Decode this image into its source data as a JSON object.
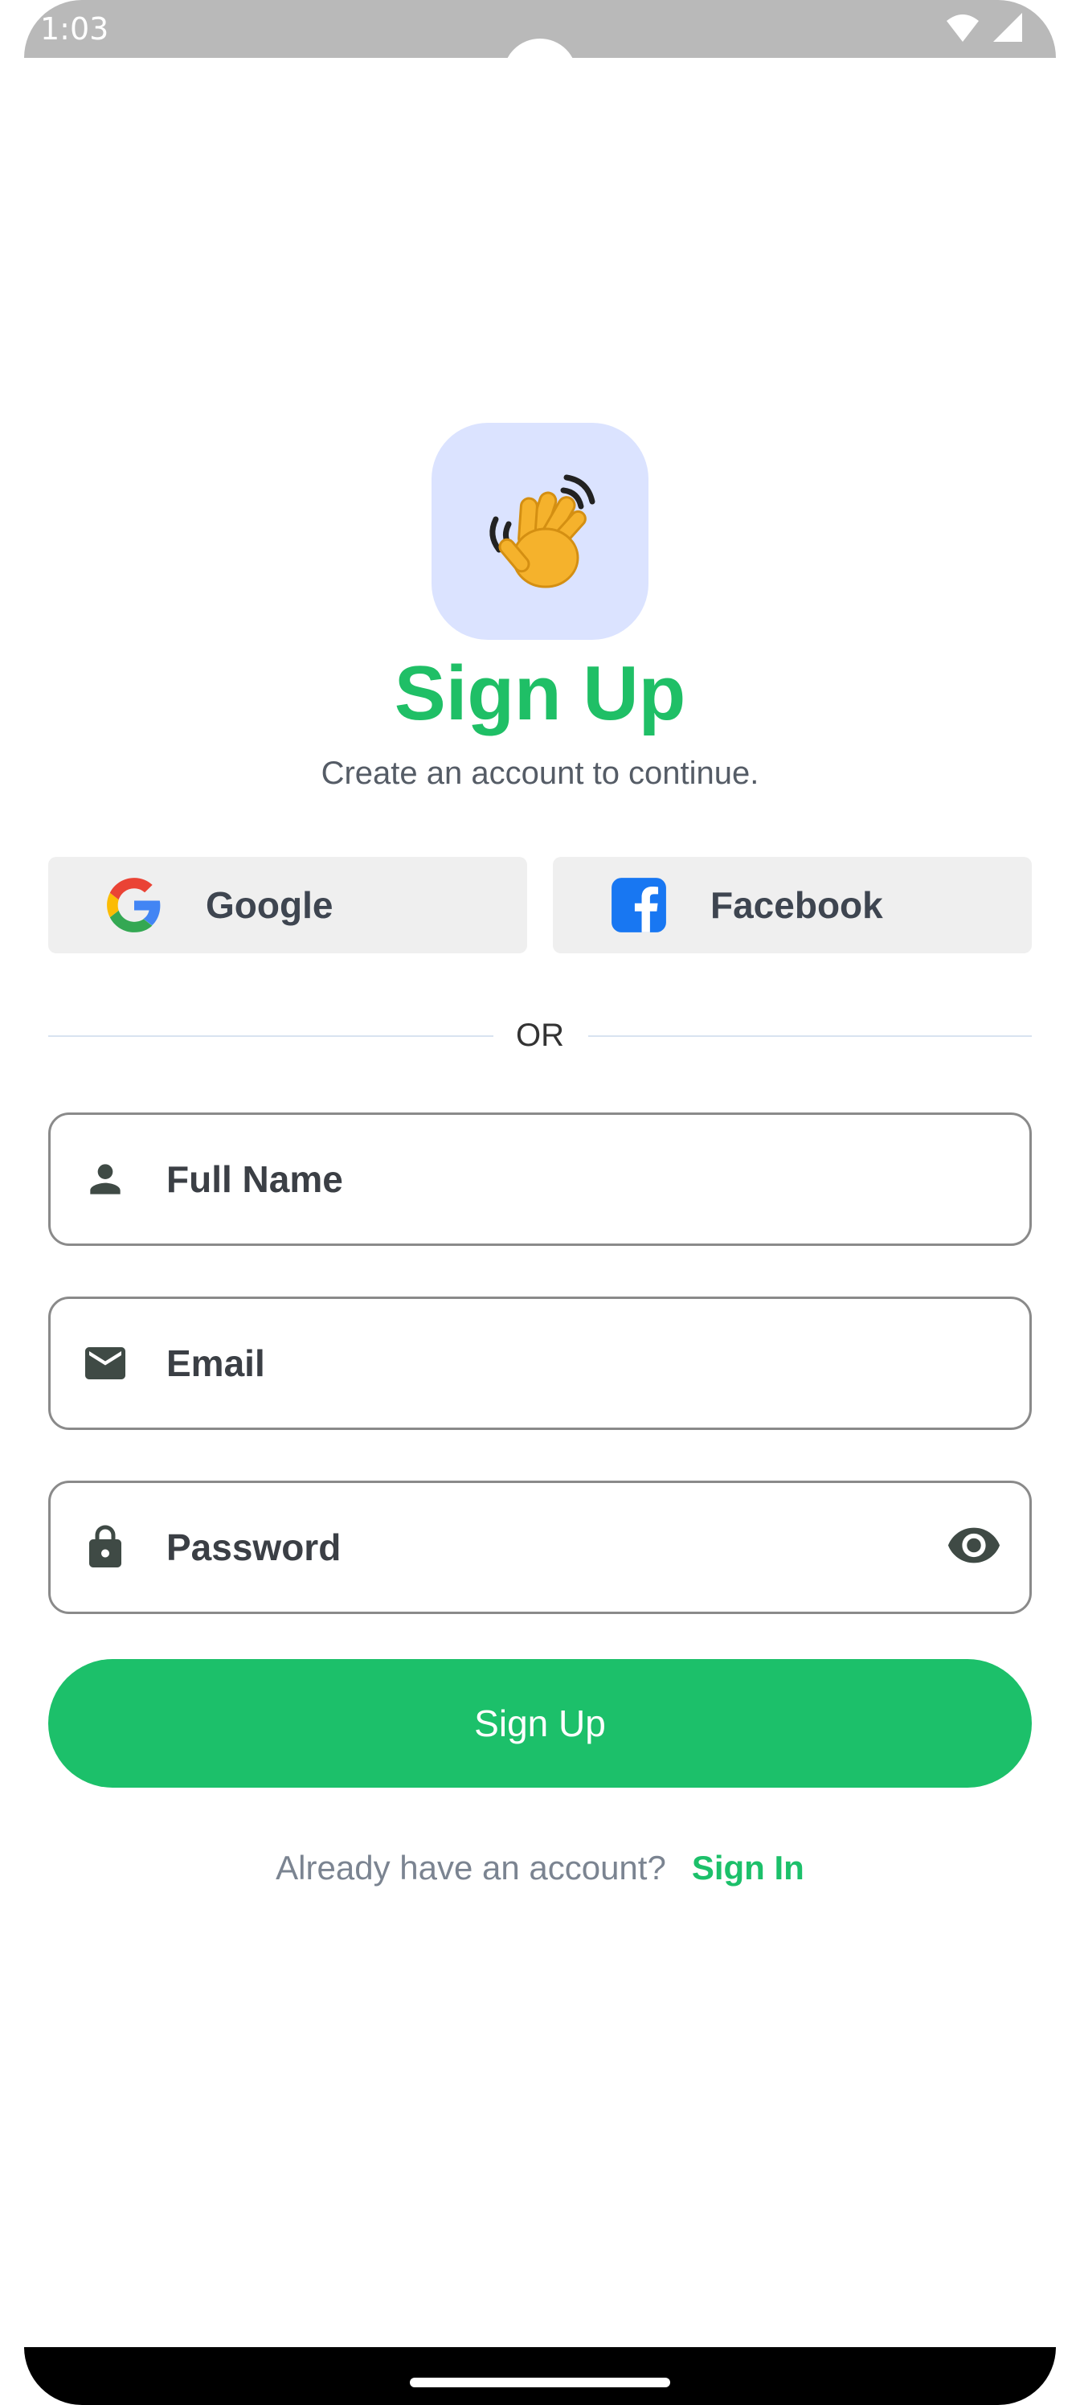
{
  "status_bar": {
    "time": "1:03",
    "icons": [
      "wifi-icon",
      "signal-icon"
    ]
  },
  "logo": {
    "icon": "waving-hand-icon",
    "background": "#dbe3ff"
  },
  "header": {
    "title": "Sign Up",
    "subtitle": "Create an account to continue."
  },
  "social": {
    "google_label": "Google",
    "facebook_label": "Facebook"
  },
  "divider": {
    "text": "OR"
  },
  "form": {
    "full_name": {
      "placeholder": "Full Name",
      "icon": "person-icon"
    },
    "email": {
      "placeholder": "Email",
      "icon": "mail-icon"
    },
    "password": {
      "placeholder": "Password",
      "icon": "lock-icon",
      "toggle_icon": "eye-icon"
    }
  },
  "actions": {
    "signup_label": "Sign Up"
  },
  "footer": {
    "question": "Already have an account?",
    "signin_label": "Sign In"
  },
  "colors": {
    "accent": "#1cc06a",
    "title": "#1fbf66",
    "muted": "#7b8491"
  }
}
